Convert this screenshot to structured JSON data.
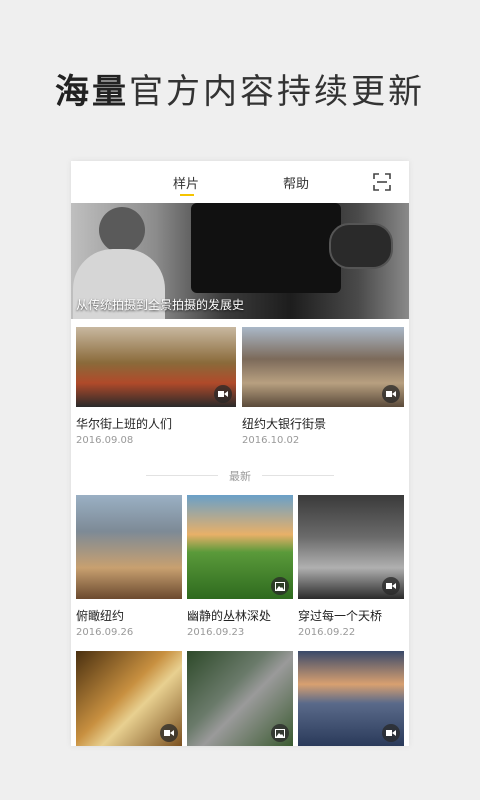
{
  "headline": {
    "bold": "海量",
    "rest": "官方内容持续更新"
  },
  "tabs": [
    {
      "label": "样片",
      "active": true
    },
    {
      "label": "帮助",
      "active": false
    }
  ],
  "accent_color": "#f5c400",
  "hero": {
    "caption": "从传统拍摄到全景拍摄的发展史"
  },
  "featured": [
    {
      "title": "华尔街上班的人们",
      "date": "2016.09.08",
      "badge": "video-icon"
    },
    {
      "title": "纽约大银行街景",
      "date": "2016.10.02",
      "badge": "video-icon"
    }
  ],
  "section_label": "最新",
  "latest": [
    {
      "title": "俯瞰纽约",
      "date": "2016.09.26",
      "badge": "none"
    },
    {
      "title": "幽静的丛林深处",
      "date": "2016.09.23",
      "badge": "image-icon"
    },
    {
      "title": "穿过每一个天桥",
      "date": "2016.09.22",
      "badge": "video-icon"
    },
    {
      "badge": "video-icon"
    },
    {
      "badge": "image-icon"
    },
    {
      "badge": "video-icon"
    }
  ]
}
